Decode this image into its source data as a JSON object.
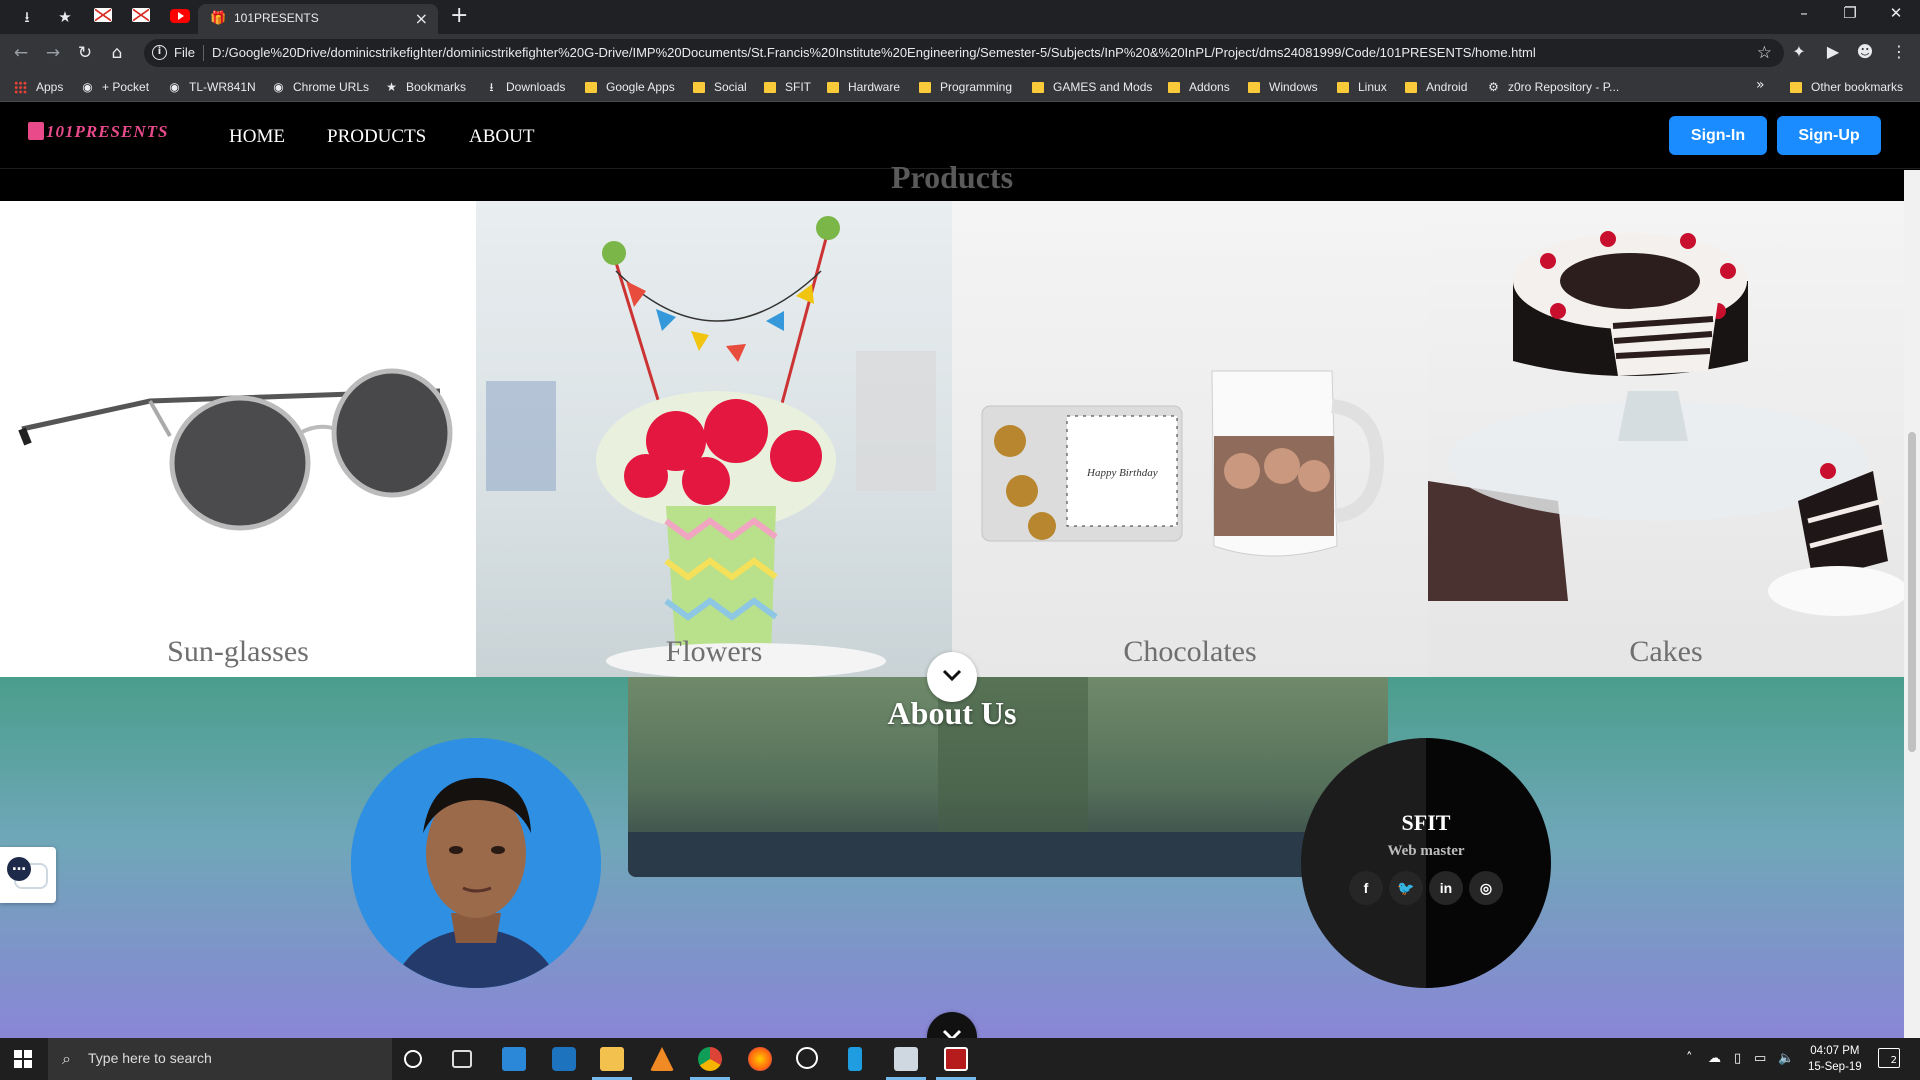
{
  "browser": {
    "tab_title": "101PRESENTS",
    "file_label": "File",
    "url": "D:/Google%20Drive/dominicstrikefighter/dominicstrikefighter%20G-Drive/IMP%20Documents/St.Francis%20Institute%20Engineering/Semester-5/Subjects/InP%20&%20InPL/Project/dms24081999/Code/101PRESENTS/home.html",
    "bookmarks": [
      "Apps",
      "+ Pocket",
      "TL-WR841N",
      "Chrome URLs",
      "Bookmarks",
      "Downloads",
      "Google Apps",
      "Social",
      "SFIT",
      "Hardware",
      "Programming",
      "GAMES and Mods",
      "Addons",
      "Windows",
      "Linux",
      "Android",
      "z0ro Repository - P..."
    ],
    "other_bookmarks": "Other bookmarks"
  },
  "site": {
    "logo_text": "101PRESENTS",
    "nav": {
      "home": "HOME",
      "products": "PRODUCTS",
      "about": "ABOUT"
    },
    "signin_label": "Sign-In",
    "signup_label": "Sign-Up",
    "products_title": "Products",
    "products": [
      {
        "label": "Sun-glasses"
      },
      {
        "label": "Flowers"
      },
      {
        "label": "Chocolates"
      },
      {
        "label": "Cakes"
      }
    ],
    "about_title": "About Us",
    "team": {
      "name": "SFIT",
      "role": "Web master",
      "socials": [
        "facebook",
        "twitter",
        "linkedin",
        "instagram"
      ]
    }
  },
  "taskbar": {
    "search_placeholder": "Type here to search",
    "time": "04:07 PM",
    "date": "15-Sep-19",
    "notifications": "2"
  },
  "colors": {
    "accent": "#1a8cff",
    "nav_bg": "#000000",
    "logo": "#e84a8a"
  }
}
